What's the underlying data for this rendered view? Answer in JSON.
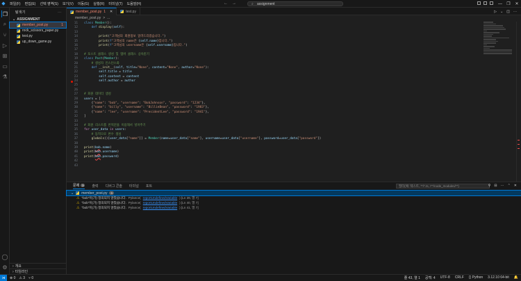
{
  "menu": [
    "파일(F)",
    "편집(E)",
    "선택 영역(S)",
    "보기(V)",
    "이동(G)",
    "실행(R)",
    "터미널(T)",
    "도움말(H)"
  ],
  "search": {
    "value": "assignment"
  },
  "sidebar": {
    "title": "탐색기",
    "folder": "ASSIGNMENT",
    "files": [
      {
        "name": "member_post.py",
        "errors": "1"
      },
      {
        "name": "rock_scissors_paper.py",
        "errors": ""
      },
      {
        "name": "test.py",
        "errors": ""
      },
      {
        "name": "up_down_game.py",
        "errors": ""
      }
    ],
    "outline": "개요",
    "timeline": "타임라인"
  },
  "tabs": [
    {
      "label": "member_post.py",
      "badge": "1"
    },
    {
      "label": "test.py",
      "badge": ""
    }
  ],
  "breadcrumb": [
    "member_post.py",
    ">",
    "..."
  ],
  "code_lines": [
    {
      "n": "11",
      "html": "<span class='k'>class</span> <span class='cl'>Member</span>():"
    },
    {
      "n": "12",
      "html": "    <span class='k'>def</span> <span class='f'>display</span>(<span class='v'>self</span>):"
    },
    {
      "n": "13",
      "html": ""
    },
    {
      "n": "14",
      "html": "        <span class='f'>print</span>(<span class='s'>\"고객님의 회원정보 알려드리겠습니다.\"</span>)"
    },
    {
      "n": "15",
      "html": "        <span class='f'>print</span>(<span class='k'>f</span><span class='s'>\"고객님의 name은 </span>{<span class='v'>self</span>.<span class='v'>name</span>}<span class='s'>입니다.\"</span>)"
    },
    {
      "n": "16",
      "html": "        <span class='f'>print</span>(<span class='k'>f</span><span class='s'>\"고객님의 username은 </span>{<span class='v'>self</span>.<span class='v'>username</span>}<span class='s'>입니다.\"</span>)"
    },
    {
      "n": "17",
      "html": ""
    },
    {
      "n": "18",
      "html": "<span class='c'># 포스트 클래스 생성 및 멤버 클래스 상속받기</span>"
    },
    {
      "n": "19",
      "html": "<span class='k'>class</span> <span class='cl'>Post</span>(<span class='cl'>Member</span>):"
    },
    {
      "n": "20",
      "html": "    <span class='c'># 생성자 인스턴스화</span>"
    },
    {
      "n": "21",
      "html": "    <span class='k'>def</span> <span class='f'>__init__</span>(<span class='v'>self</span>, <span class='v'>title</span>=<span class='s'>\"None\"</span>, <span class='v'>content</span>=<span class='s'>\"None\"</span>, <span class='v'>author</span>=<span class='s'>\"None\"</span>):"
    },
    {
      "n": "22",
      "html": "        <span class='v'>self</span>.<span class='v'>title</span> = <span class='v'>title</span>"
    },
    {
      "n": "23",
      "html": "        <span class='v'>self</span>.<span class='v'>content</span> = <span class='v'>content</span>"
    },
    {
      "n": "24",
      "html": "        <span class='v'>self</span>.<span class='v'>author</span> = <span class='v'>author</span>",
      "bp": true
    },
    {
      "n": "25",
      "html": ""
    },
    {
      "n": "26",
      "html": ""
    },
    {
      "n": "27",
      "html": "<span class='c'># 회원 데이터 생성</span>"
    },
    {
      "n": "28",
      "html": "<span class='v'>users</span> = ["
    },
    {
      "n": "29",
      "html": "    {<span class='s'>\"name\"</span>: <span class='s'>\"bob\"</span>, <span class='s'>\"username\"</span>: <span class='s'>\"BobJohnson\"</span>, <span class='s'>\"password\"</span>: <span class='s'>\"1234\"</span>},"
    },
    {
      "n": "30",
      "html": "    {<span class='s'>\"name\"</span>: <span class='s'>\"billy\"</span>, <span class='s'>\"username\"</span>: <span class='s'>\"BillieBean\"</span>, <span class='s'>\"password\"</span>: <span class='s'>\"1983\"</span>},"
    },
    {
      "n": "31",
      "html": "    {<span class='s'>\"name\"</span>: <span class='s'>\"lee\"</span>, <span class='s'>\"username\"</span>: <span class='s'>\"PresidentLee\"</span>, <span class='s'>\"password\"</span>: <span class='s'>\"1941\"</span>},"
    },
    {
      "n": "32",
      "html": "]"
    },
    {
      "n": "33",
      "html": ""
    },
    {
      "n": "34",
      "html": "<span class='c'># 회원 리스트를 반복문을 이용해서 넣어주기</span>"
    },
    {
      "n": "35",
      "html": "<span class='kf'>for</span> <span class='v'>user_data</span> <span class='kf'>in</span> <span class='v'>users</span>:"
    },
    {
      "n": "36",
      "html": "    <span class='c'># 동적으로 변수 생성</span>"
    },
    {
      "n": "37",
      "html": "    <span class='f'>globals</span>()[<span class='v'>user_data</span>[<span class='s'>\"name\"</span>]] = <span class='cl'>Member</span>(<span class='v'>name</span>=<span class='v'>user_data</span>[<span class='s'>\"name\"</span>], <span class='v'>username</span>=<span class='v'>user_data</span>[<span class='s'>\"username\"</span>], <span class='v'>password</span>=<span class='v'>user_data</span>[<span class='s'>\"password\"</span>])"
    },
    {
      "n": "38",
      "html": ""
    },
    {
      "n": "39",
      "html": "<span class='f'>print</span>(<span class='v u'>bob</span>.<span class='v'>name</span>)"
    },
    {
      "n": "40",
      "html": "<span class='f'>print</span>(<span class='v u'>bob</span>.<span class='v'>username</span>)"
    },
    {
      "n": "41",
      "html": "<span class='f'>print</span>(<span class='v u'>bob</span>.<span class='v'>password</span>)"
    },
    {
      "n": "42",
      "html": ""
    },
    {
      "n": "43",
      "html": ""
    }
  ],
  "panel": {
    "tabs": [
      "문제",
      "출력",
      "디버그 콘솔",
      "터미널",
      "포트"
    ],
    "problem_badge": "3",
    "filter_placeholder": "필터(예: 텍스트, **/*.ts, !**/node_modules/**)",
    "file": "member_post.py",
    "file_count": "3",
    "problems": [
      {
        "msg": "\"bob\"이(가) 정의되지 않았습니다.",
        "src": "Pylance(",
        "code": "reportUndefinedVariable",
        "loc": ") [Ln 39, 열 7]"
      },
      {
        "msg": "\"bob\"이(가) 정의되지 않았습니다.",
        "src": "Pylance(",
        "code": "reportUndefinedVariable",
        "loc": ") [Ln 40, 열 7]"
      },
      {
        "msg": "\"bob\"이(가) 정의되지 않았습니다.",
        "src": "Pylance(",
        "code": "reportUndefinedVariable",
        "loc": ") [Ln 41, 열 7]"
      }
    ]
  },
  "status": {
    "left": [
      "⊗ 0",
      "⚠ 3",
      "⑂ 0"
    ],
    "right": [
      "줄 43, 열 1",
      "공백: 4",
      "UTF-8",
      "CRLF",
      "{} Python",
      "3.12.10 64-bit",
      "🔔"
    ]
  },
  "colors": {
    "accent": "#0078d4",
    "error": "#f48771",
    "warning": "#cca700"
  }
}
